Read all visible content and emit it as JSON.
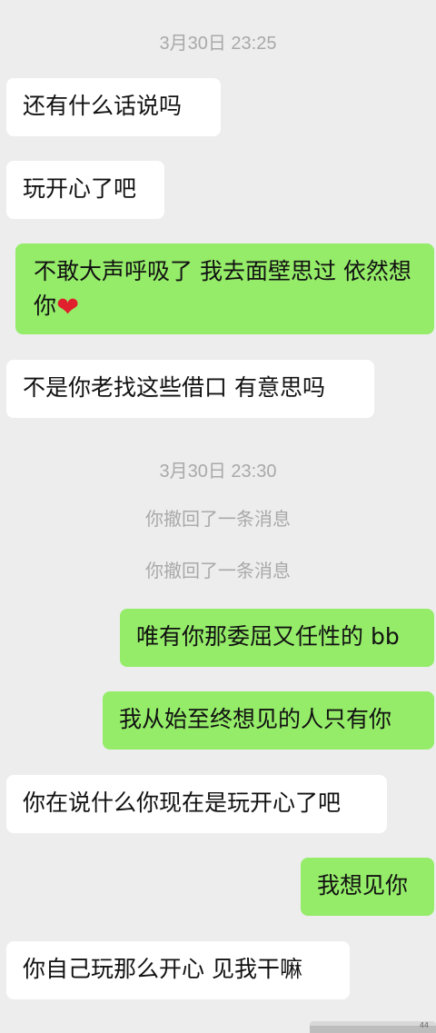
{
  "timestamps": [
    "3月30日 23:25",
    "3月30日 23:30"
  ],
  "system_messages": [
    "你撤回了一条消息",
    "你撤回了一条消息"
  ],
  "messages": [
    {
      "side": "left",
      "text": "还有什么话说吗"
    },
    {
      "side": "left",
      "text": "玩开心了吧"
    },
    {
      "side": "right",
      "text": "不敢大声呼吸了 我去面壁思过 依然想你",
      "emoji": "❤"
    },
    {
      "side": "left",
      "text": "不是你老找这些借口 有意思吗"
    },
    {
      "side": "right",
      "text": "唯有你那委屈又任性的 bb"
    },
    {
      "side": "right",
      "text": "我从始至终想见的人只有你"
    },
    {
      "side": "left",
      "text": "你在说什么你现在是玩开心了吧"
    },
    {
      "side": "right",
      "text": "我想见你"
    },
    {
      "side": "left",
      "text": "你自己玩那么开心 见我干嘛"
    }
  ],
  "thumbnail": {
    "tag": "44"
  },
  "colors": {
    "background": "#ededed",
    "incoming": "#ffffff",
    "outgoing": "#95ec69",
    "meta_text": "#a9a9a9"
  }
}
